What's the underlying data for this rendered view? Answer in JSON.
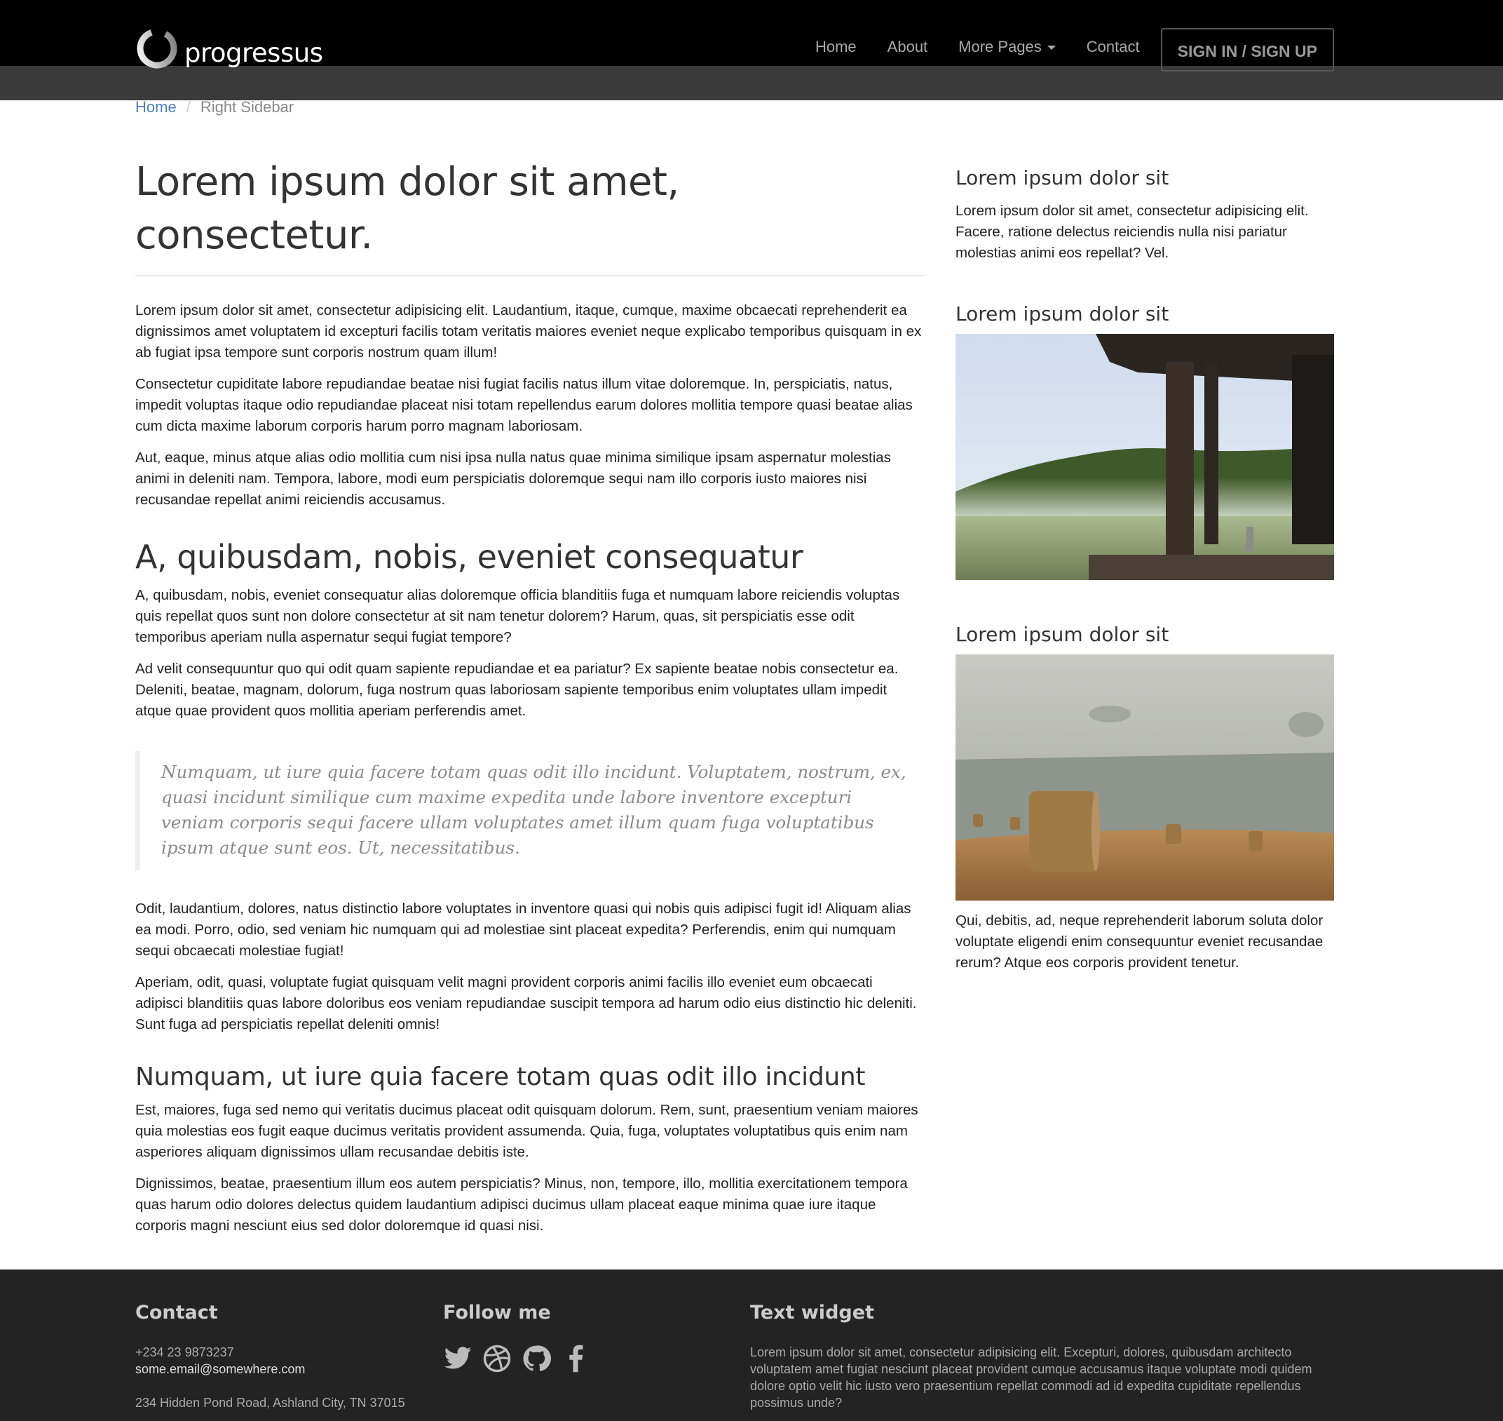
{
  "brand": {
    "name": "progressus"
  },
  "nav": {
    "items": [
      {
        "label": "Home"
      },
      {
        "label": "About"
      },
      {
        "label": "More Pages"
      },
      {
        "label": "Contact"
      }
    ],
    "signin_label": "SIGN IN / SIGN UP"
  },
  "breadcrumb": {
    "home": "Home",
    "separator": "/",
    "current": "Right Sidebar"
  },
  "article": {
    "title": "Lorem ipsum dolor sit amet, consectetur.",
    "intro": [
      "Lorem ipsum dolor sit amet, consectetur adipisicing elit. Laudantium, itaque, cumque, maxime obcaecati reprehenderit ea dignissimos amet voluptatem id excepturi facilis totam veritatis maiores eveniet neque explicabo temporibus quisquam in ex ab fugiat ipsa tempore sunt corporis nostrum quam illum!",
      "Consectetur cupiditate labore repudiandae beatae nisi fugiat facilis natus illum vitae doloremque. In, perspiciatis, natus, impedit voluptas itaque odio repudiandae placeat nisi totam repellendus earum dolores mollitia tempore quasi beatae alias cum dicta maxime laborum corporis harum porro magnam laboriosam.",
      "Aut, eaque, minus atque alias odio mollitia cum nisi ipsa nulla natus quae minima similique ipsam aspernatur molestias animi in deleniti nam. Tempora, labore, modi eum perspiciatis doloremque sequi nam illo corporis iusto maiores nisi recusandae repellat animi reiciendis accusamus."
    ],
    "section2_title": "A, quibusdam, nobis, eveniet consequatur",
    "section2": [
      "A, quibusdam, nobis, eveniet consequatur alias doloremque officia blanditiis fuga et numquam labore reiciendis voluptas quis repellat quos sunt non dolore consectetur at sit nam tenetur dolorem? Harum, quas, sit perspiciatis esse odit temporibus aperiam nulla aspernatur sequi fugiat tempore?",
      "Ad velit consequuntur quo qui odit quam sapiente repudiandae et ea pariatur? Ex sapiente beatae nobis consectetur ea. Deleniti, beatae, magnam, dolorum, fuga nostrum quas laboriosam sapiente temporibus enim voluptates ullam impedit atque quae provident quos mollitia aperiam perferendis amet."
    ],
    "blockquote": "Numquam, ut iure quia facere totam quas odit illo incidunt. Voluptatem, nostrum, ex, quasi incidunt similique cum maxime expedita unde labore inventore excepturi veniam corporis sequi facere ullam voluptates amet illum quam fuga voluptatibus ipsum atque sunt eos. Ut, necessitatibus.",
    "after_quote": [
      "Odit, laudantium, dolores, natus distinctio labore voluptates in inventore quasi qui nobis quis adipisci fugit id! Aliquam alias ea modi. Porro, odio, sed veniam hic numquam qui ad molestiae sint placeat expedita? Perferendis, enim qui numquam sequi obcaecati molestiae fugiat!",
      "Aperiam, odit, quasi, voluptate fugiat quisquam velit magni provident corporis animi facilis illo eveniet eum obcaecati adipisci blanditiis quas labore doloribus eos veniam repudiandae suscipit tempora ad harum odio eius distinctio hic deleniti. Sunt fuga ad perspiciatis repellat deleniti omnis!"
    ],
    "section3_title": "Numquam, ut iure quia facere totam quas odit illo incidunt",
    "section3": [
      "Est, maiores, fuga sed nemo qui veritatis ducimus placeat odit quisquam dolorum. Rem, sunt, praesentium veniam maiores quia molestias eos fugit eaque ducimus veritatis provident assumenda. Quia, fuga, voluptates voluptatibus quis enim nam asperiores aliquam dignissimos ullam recusandae debitis iste.",
      "Dignissimos, beatae, praesentium illum eos autem perspiciatis? Minus, non, tempore, illo, mollitia exercitationem tempora quas harum odio dolores delectus quidem laudantium adipisci ducimus ullam placeat eaque minima quae iure itaque corporis magni nesciunt eius sed dolor doloremque id quasi nisi."
    ]
  },
  "sidebar": {
    "widget1": {
      "title": "Lorem ipsum dolor sit",
      "text": "Lorem ipsum dolor sit amet, consectetur adipisicing elit. Facere, ratione delectus reiciendis nulla nisi pariatur molestias animi eos repellat? Vel."
    },
    "widget2": {
      "title": "Lorem ipsum dolor sit",
      "image": "lake-dock-photo"
    },
    "widget3": {
      "title": "Lorem ipsum dolor sit",
      "image": "hay-bales-field-photo",
      "text": "Qui, debitis, ad, neque reprehenderit laborum soluta dolor voluptate eligendi enim consequuntur eveniet recusandae rerum? Atque eos corporis provident tenetur."
    }
  },
  "footer": {
    "contact": {
      "title": "Contact",
      "phone": "+234 23 9873237",
      "email": "some.email@somewhere.com",
      "address": "234 Hidden Pond Road, Ashland City, TN 37015"
    },
    "follow": {
      "title": "Follow me",
      "icons": [
        "twitter-icon",
        "dribbble-icon",
        "github-icon",
        "facebook-icon"
      ]
    },
    "text_widget": {
      "title": "Text widget",
      "text": "Lorem ipsum dolor sit amet, consectetur adipisicing elit. Excepturi, dolores, quibusdam architecto voluptatem amet fugiat nesciunt placeat provident cumque accusamus itaque voluptate modi quidem dolore optio velit hic iusto vero praesentium repellat commodi ad id expedita cupiditate repellendus possimus unde?"
    }
  },
  "colors": {
    "navbar_bg": "#000000",
    "link": "#4b7fbf",
    "footer_bg": "#232323"
  }
}
